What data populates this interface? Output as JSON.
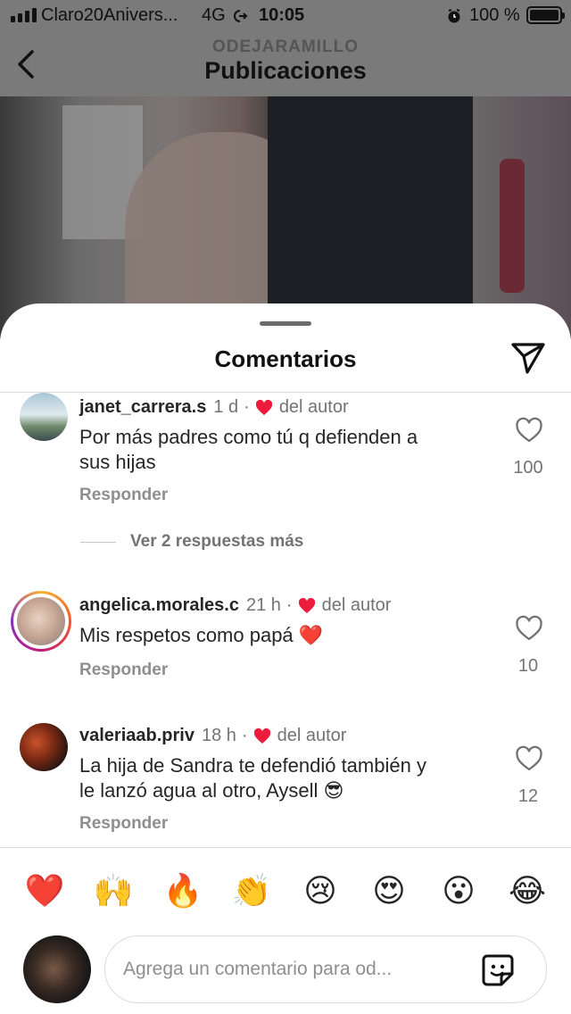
{
  "status_bar": {
    "carrier": "Claro20Anivers...",
    "network": "4G",
    "time": "10:05",
    "battery": "100 %"
  },
  "header": {
    "subtitle": "ODEJARAMILLO",
    "title": "Publicaciones"
  },
  "sheet": {
    "title": "Comentarios"
  },
  "comments": [
    {
      "username": "janet_carrera.s",
      "time": "1 d",
      "author_like_label": "del autor",
      "text_lines": [
        "Por más padres como tú q defienden a",
        "sus hijas"
      ],
      "like_count": "100",
      "reply_label": "Responder"
    },
    {
      "username": "angelica.morales.c",
      "time": "21 h",
      "author_like_label": "del autor",
      "text_lines": [
        "Mis respetos como papá ❤️"
      ],
      "like_count": "10",
      "reply_label": "Responder"
    },
    {
      "username": "valeriaab.priv",
      "time": "18 h",
      "author_like_label": "del autor",
      "text_lines": [
        "La hija de Sandra te defendió también y",
        "le lanzó agua al otro, Aysell 😎"
      ],
      "like_count": "12",
      "reply_label": "Responder"
    }
  ],
  "more_replies": "Ver 2 respuestas más",
  "emoji_bar": [
    "❤️",
    "🙌",
    "🔥",
    "👏",
    "😢",
    "😍",
    "😮",
    "😂"
  ],
  "composer": {
    "placeholder": "Agrega un comentario para od..."
  },
  "colors": {
    "heart_red": "#ed1c3c",
    "muted_text": "#737373",
    "divider": "#dbdbdb"
  }
}
